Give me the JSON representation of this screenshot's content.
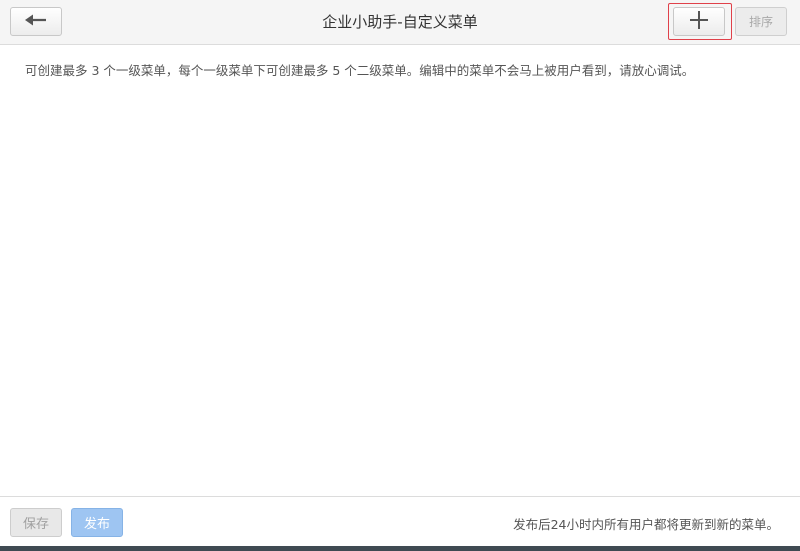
{
  "header": {
    "title": "企业小助手-自定义菜单",
    "back_icon": "arrow-left-icon",
    "add_icon": "plus-icon",
    "sort_label": "排序",
    "highlight_color": "#e0414a"
  },
  "main": {
    "notice": "可创建最多 3 个一级菜单，每个一级菜单下可创建最多 5 个二级菜单。编辑中的菜单不会马上被用户看到，请放心调试。"
  },
  "footer": {
    "save_label": "保存",
    "publish_label": "发布",
    "note": "发布后24小时内所有用户都将更新到新的菜单。",
    "publish_color": "#9ec5f2"
  }
}
